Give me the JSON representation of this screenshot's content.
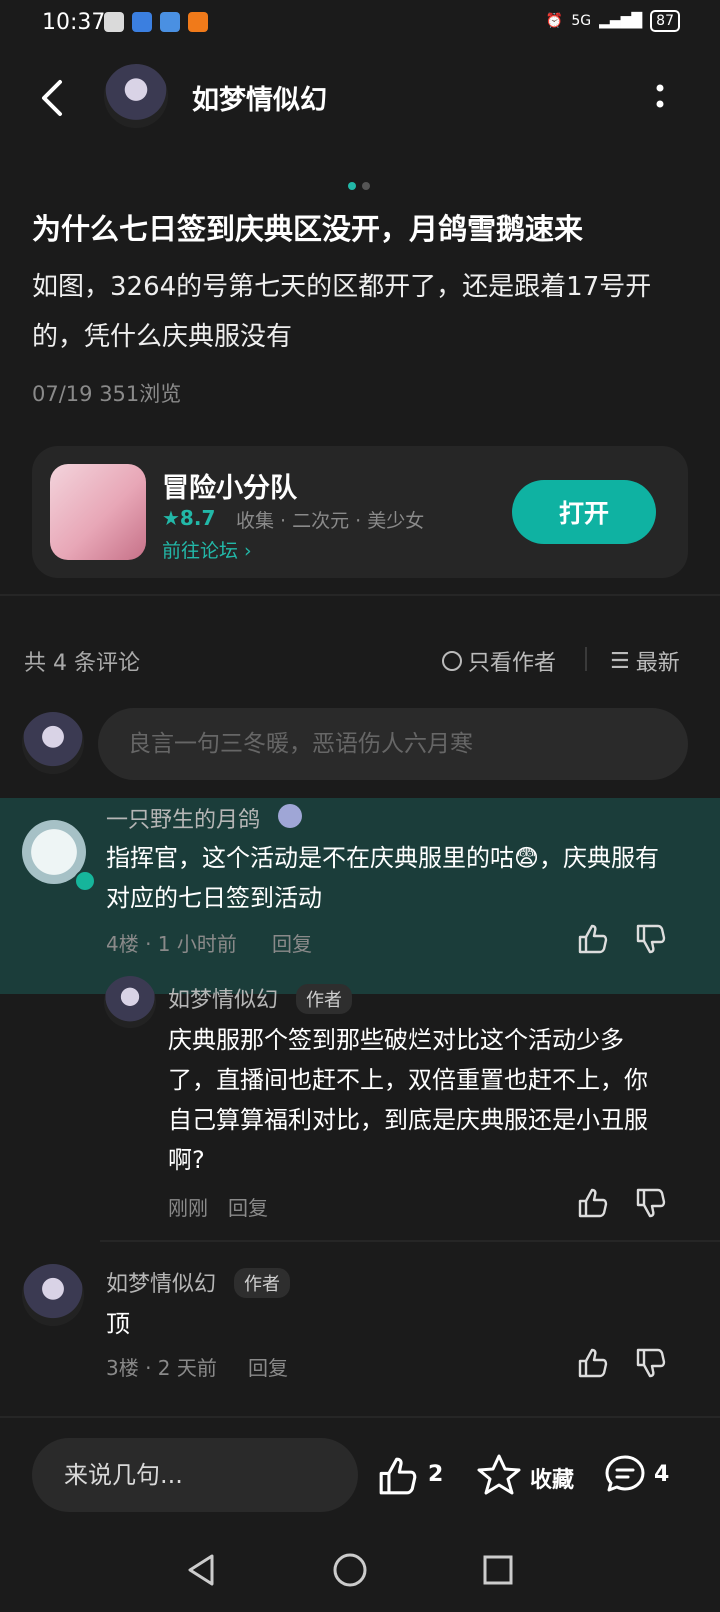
{
  "status_bar": {
    "time": "10:37",
    "battery": "87",
    "network": "5G"
  },
  "header": {
    "title": "如梦情似幻"
  },
  "post": {
    "title": "为什么七日签到庆典区没开，月鸽雪鹅速来",
    "body": "如图，3264的号第七天的区都开了，还是跟着17号开的，凭什么庆典服没有",
    "meta": "07/19  351浏览"
  },
  "game_card": {
    "name": "冒险小分队",
    "rating": "★8.7",
    "tags": "收集 · 二次元 · 美少女",
    "forum_link": "前往论坛 ›",
    "open_label": "打开"
  },
  "comments_bar": {
    "count_label": "共 4 条评论",
    "author_only": "只看作者",
    "sort": "最新",
    "input_placeholder": "良言一句三冬暖，恶语伤人六月寒"
  },
  "comments": [
    {
      "name": "一只野生的月鸽",
      "text": "指挥官，这个活动是不在庆典服里的咕😨，庆典服有对应的七日签到活动",
      "meta": "4楼 · 1 小时前",
      "reply": "回复"
    },
    {
      "name": "如梦情似幻",
      "badge": "作者",
      "text": "庆典服那个签到那些破烂对比这个活动少多了，直播间也赶不上，双倍重置也赶不上，你自己算算福利对比，到底是庆典服还是小丑服啊?",
      "meta": "刚刚",
      "reply": "回复"
    },
    {
      "name": "如梦情似幻",
      "badge": "作者",
      "text": "顶",
      "meta": "3楼 · 2 天前",
      "reply": "回复"
    }
  ],
  "bottom_bar": {
    "input_placeholder": "来说几句...",
    "like_count": "2",
    "favorite_label": "收藏",
    "comment_count": "4"
  },
  "colors": {
    "accent": "#0fb2a2",
    "highlight_bg": "#1b3d3a",
    "background": "#1b1b1b"
  }
}
